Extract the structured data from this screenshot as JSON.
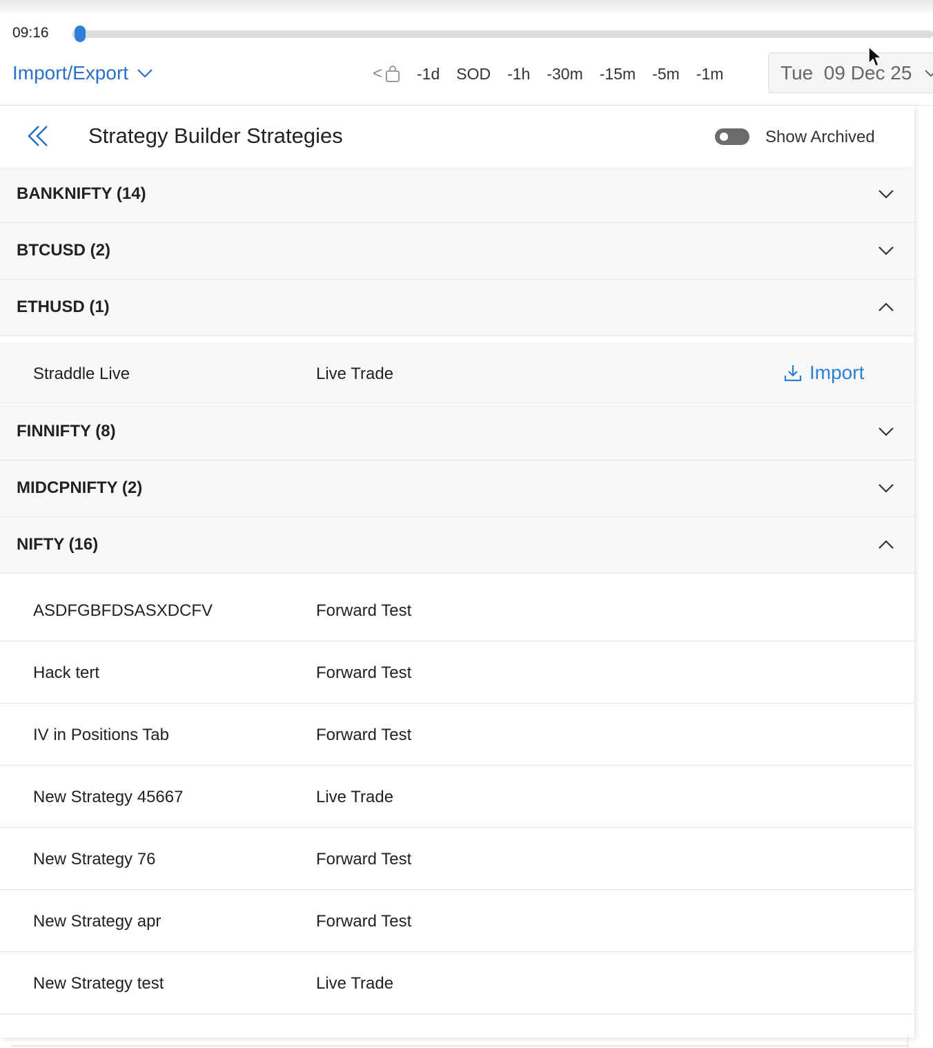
{
  "toolbar": {
    "time": "09:16",
    "slider_progress": 0.005,
    "import_export_label": "Import/Export",
    "nav_prev_glyph": "<",
    "ranges": [
      "-1d",
      "SOD",
      "-1h",
      "-30m",
      "-15m",
      "-5m",
      "-1m"
    ],
    "date_value": "Tue  09 Dec 25"
  },
  "panel": {
    "title": "Strategy Builder Strategies",
    "show_archived_label": "Show Archived",
    "show_archived_on": false,
    "groups": {
      "banknifty": "BANKNIFTY (14)",
      "btcusd": "BTCUSD (2)",
      "ethusd": "ETHUSD (1)",
      "finnifty": "FINNIFTY (8)",
      "midcpnifty": "MIDCPNIFTY (2)",
      "nifty": "NIFTY (16)"
    },
    "ethusd_rows": [
      {
        "name": "Straddle Live",
        "mode": "Live Trade",
        "action": "Import"
      }
    ],
    "nifty_rows": [
      {
        "name": "ASDFGBFDSASXDCFV",
        "mode": "Forward Test"
      },
      {
        "name": "Hack tert",
        "mode": "Forward Test"
      },
      {
        "name": "IV in Positions Tab",
        "mode": "Forward Test"
      },
      {
        "name": "New Strategy 45667",
        "mode": "Live Trade"
      },
      {
        "name": "New Strategy 76",
        "mode": "Forward Test"
      },
      {
        "name": "New Strategy apr",
        "mode": "Forward Test"
      },
      {
        "name": "New Strategy test",
        "mode": "Live Trade"
      }
    ]
  },
  "colors": {
    "accent": "#2a6fc9",
    "slider_thumb": "#2f7fd6",
    "toggle_off": "#6b6b6b",
    "group_bg": "#f8f8f8"
  },
  "icons": {
    "collapse": "double-chevron-left-icon",
    "expand": "chevron-down-icon",
    "collapse_group": "chevron-up-icon",
    "import": "download-icon",
    "shopping_bag": "shopping-bag-icon"
  }
}
